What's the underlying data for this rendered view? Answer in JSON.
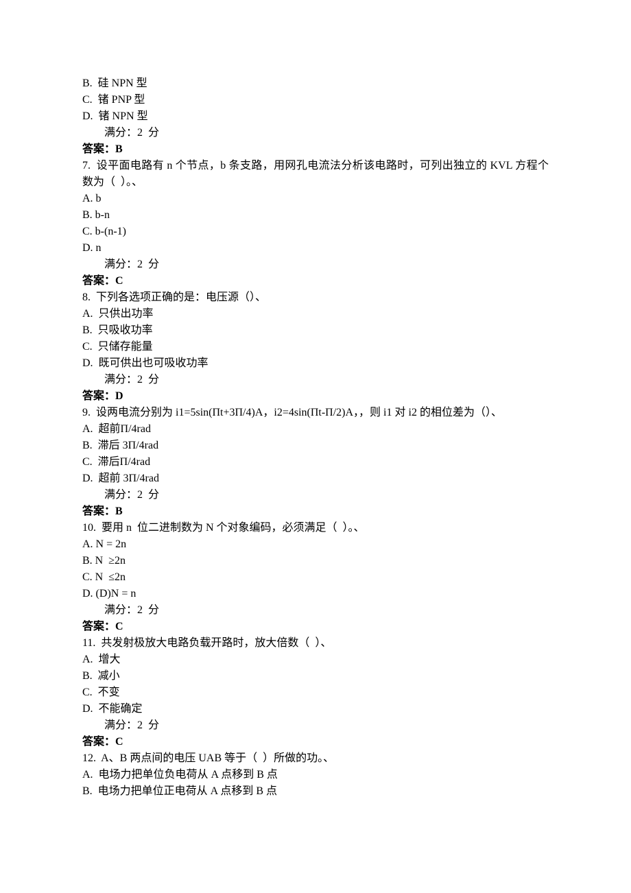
{
  "pre_options": [
    "B.  硅 NPN 型",
    "C.  锗 PNP 型",
    "D.  锗 NPN 型"
  ],
  "pre_score": "满分：2  分",
  "pre_answer": "答案：B",
  "questions": [
    {
      "stem": "7.  设平面电路有 n 个节点，b 条支路，用网孔电流法分析该电路时，可列出独立的 KVL 方程个数为（  ）。、",
      "options": [
        "A. b",
        "B. b-n",
        "C. b-(n-1)",
        "D. n"
      ],
      "score": "满分：2  分",
      "answer": "答案：C"
    },
    {
      "stem": "8.  下列各选项正确的是：电压源（）、",
      "options": [
        "A.  只供出功率",
        "B.  只吸收功率",
        "C.  只储存能量",
        "D.  既可供出也可吸收功率"
      ],
      "score": "满分：2  分",
      "answer": "答案：D"
    },
    {
      "stem": "9.  设两电流分别为 i1=5sin(Πt+3Π/4)A，i2=4sin(Πt-Π/2)A，，则 i1 对 i2 的相位差为（）、",
      "options": [
        "A.  超前Π/4rad",
        "B.  滞后 3Π/4rad",
        "C.  滞后Π/4rad",
        "D.  超前 3Π/4rad"
      ],
      "score": "满分：2  分",
      "answer": "答案：B"
    },
    {
      "stem": "10.  要用 n  位二进制数为 N 个对象编码，必须满足（  ）。、",
      "options": [
        "A. N = 2n",
        "B. N  ≥2n",
        "C. N  ≤2n",
        "D. (D)N = n"
      ],
      "score": "满分：2  分",
      "answer": "答案：C"
    },
    {
      "stem": "11.  共发射极放大电路负载开路时，放大倍数（  ）、",
      "options": [
        "A.  增大",
        "B.  减小",
        "C.  不变",
        "D.  不能确定"
      ],
      "score": "满分：2  分",
      "answer": "答案：C"
    },
    {
      "stem": "12.  A、B 两点间的电压 UAB 等于（  ）所做的功。、",
      "options": [
        "A.  电场力把单位负电荷从 A 点移到 B 点",
        "B.  电场力把单位正电荷从 A 点移到 B 点"
      ],
      "score": "",
      "answer": ""
    }
  ]
}
